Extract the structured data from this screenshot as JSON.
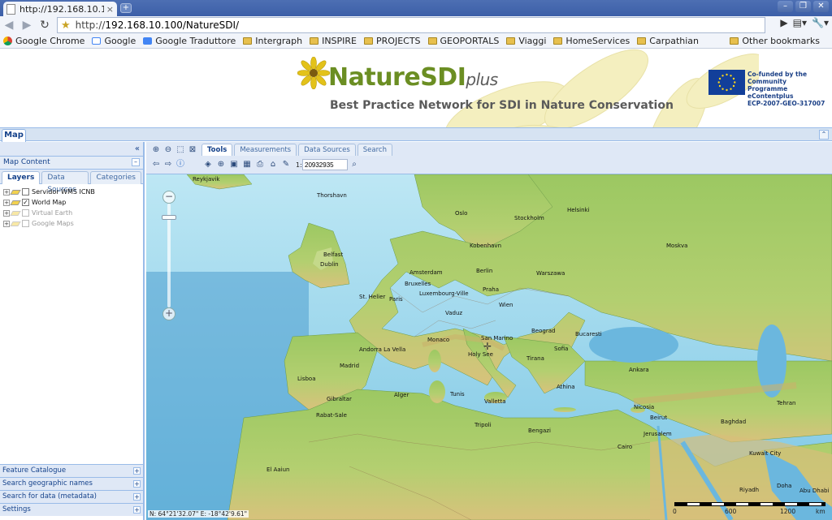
{
  "browser": {
    "tab_title": "http://192.168.10.1...",
    "tab_close": "×",
    "new_tab": "+",
    "url_prefix": "http://",
    "url_host": "192.168.10.100/NatureSDI/",
    "window_buttons": [
      "–",
      "❐",
      "✕"
    ],
    "bookmarks": [
      {
        "label": "Google Chrome",
        "icon": "chrome-icon"
      },
      {
        "label": "Google",
        "icon": "google-icon"
      },
      {
        "label": "Google Traduttore",
        "icon": "translate-icon"
      },
      {
        "label": "Intergraph",
        "icon": "folder-icon"
      },
      {
        "label": "INSPIRE",
        "icon": "folder-icon"
      },
      {
        "label": "PROJECTS",
        "icon": "folder-icon"
      },
      {
        "label": "GEOPORTALS",
        "icon": "folder-icon"
      },
      {
        "label": "Viaggi",
        "icon": "folder-icon"
      },
      {
        "label": "HomeServices",
        "icon": "folder-icon"
      },
      {
        "label": "Carpathian",
        "icon": "folder-icon"
      }
    ],
    "other_bookmarks": "Other bookmarks"
  },
  "banner": {
    "brand": "NatureSDI",
    "brand_suffix": "plus",
    "tagline": "Best Practice Network for SDI in Nature Conservation",
    "eu_text": [
      "Co-funded by the Community",
      "Programme eContentplus",
      "ECP-2007-GEO-317007"
    ]
  },
  "app": {
    "main_tab": "Map",
    "sidebar": {
      "section_title": "Map Content",
      "tabs": [
        "Layers",
        "Data Sources",
        "Categories"
      ],
      "layers": [
        {
          "name": "Servidor WMS ICNB",
          "checked": false,
          "enabled": true
        },
        {
          "name": "World Map",
          "checked": true,
          "enabled": true
        },
        {
          "name": "Virtual Earth",
          "checked": false,
          "enabled": false
        },
        {
          "name": "Google Maps",
          "checked": false,
          "enabled": false
        }
      ],
      "accordion": [
        "Feature Catalogue",
        "Search geographic names",
        "Search for data (metadata)",
        "Settings"
      ]
    },
    "toolbar": {
      "tabs": [
        "Tools",
        "Measurements",
        "Data Sources",
        "Search"
      ],
      "scale_prefix": "1:",
      "scale_value": "20932935"
    },
    "map": {
      "coords": "N: 64°21'32.07\" E: -18°42'9.61\"",
      "scale_labels": [
        "0",
        "600",
        "1200",
        "km"
      ],
      "places": [
        {
          "name": "Reykjavik"
        },
        {
          "name": "Thorshavn"
        },
        {
          "name": "Oslo"
        },
        {
          "name": "Helsinki"
        },
        {
          "name": "Stockholm"
        },
        {
          "name": "Kobenhavn"
        },
        {
          "name": "Moskva"
        },
        {
          "name": "Belfast"
        },
        {
          "name": "Dublin"
        },
        {
          "name": "Amsterdam"
        },
        {
          "name": "Berlin"
        },
        {
          "name": "Warszawa"
        },
        {
          "name": "Bruxelles"
        },
        {
          "name": "Luxembourg-Ville"
        },
        {
          "name": "Praha"
        },
        {
          "name": "St. Helier"
        },
        {
          "name": "Paris"
        },
        {
          "name": "Wien"
        },
        {
          "name": "Vaduz"
        },
        {
          "name": "Monaco"
        },
        {
          "name": "San Marino"
        },
        {
          "name": "Beograd"
        },
        {
          "name": "Bucaresti"
        },
        {
          "name": "Andorra La Vella"
        },
        {
          "name": "Holy See"
        },
        {
          "name": "Sofia"
        },
        {
          "name": "Tirana"
        },
        {
          "name": "Madrid"
        },
        {
          "name": "Lisboa"
        },
        {
          "name": "Ankara"
        },
        {
          "name": "Athina"
        },
        {
          "name": "Gibraltar"
        },
        {
          "name": "Alger"
        },
        {
          "name": "Tunis"
        },
        {
          "name": "Valletta"
        },
        {
          "name": "Nicosia"
        },
        {
          "name": "Tehran"
        },
        {
          "name": "Rabat-Sale"
        },
        {
          "name": "Beirut"
        },
        {
          "name": "Baghdad"
        },
        {
          "name": "Jerusalem"
        },
        {
          "name": "Tripoli"
        },
        {
          "name": "Bengazi"
        },
        {
          "name": "Cairo"
        },
        {
          "name": "Kuwait City"
        },
        {
          "name": "El Aaiun"
        },
        {
          "name": "Riyadh"
        },
        {
          "name": "Doha"
        },
        {
          "name": "Abu Dhabi"
        }
      ]
    }
  },
  "colors": {
    "ext_blue": "#99bbe8",
    "brand_green": "#6b8e23",
    "sea": "#9fd9ee",
    "land": "#a8cf6a"
  }
}
